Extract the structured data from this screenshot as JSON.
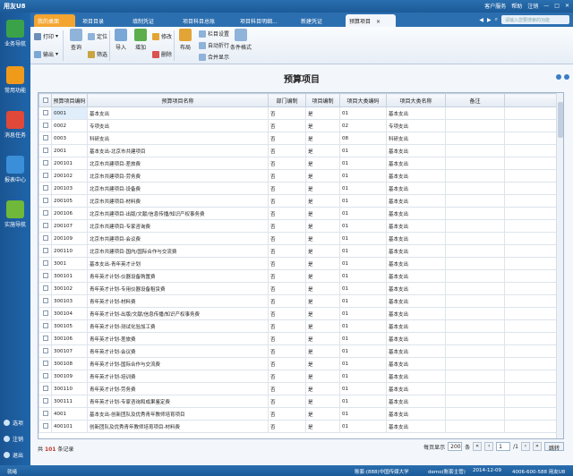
{
  "app": {
    "logo": "用友U8",
    "top_right": [
      "客户服务",
      "帮助",
      "注销"
    ],
    "search_placeholder": "请输入您要搜索的功能"
  },
  "sidebar": {
    "items": [
      {
        "label": "业务导航",
        "color": "#3aa34a"
      },
      {
        "label": "常用功能",
        "color": "#f09a1a"
      },
      {
        "label": "消息任务",
        "color": "#e0483a"
      },
      {
        "label": "报表中心",
        "color": "#3b8fd9"
      },
      {
        "label": "实施导航",
        "color": "#6fb83a"
      }
    ],
    "bottom": [
      "选项",
      "注销",
      "退出"
    ]
  },
  "tabs": [
    {
      "label": "我的桌面"
    },
    {
      "label": "项目目录"
    },
    {
      "label": "填制凭证"
    },
    {
      "label": "项目科目总账"
    },
    {
      "label": "项目科目明细..."
    },
    {
      "label": "新建凭证"
    },
    {
      "label": "预算项目"
    }
  ],
  "toolbar": {
    "print": "打印",
    "output": "输出",
    "query": "查询",
    "locate": "定位",
    "filter": "筛选",
    "import": "导入",
    "add": "增加",
    "modify": "修改",
    "delete": "删除",
    "layout": "布局",
    "column_settings": "栏目设置",
    "auto_wrap": "自动折行",
    "merge_display": "合并显示",
    "cond_format": "条件格式"
  },
  "page": {
    "title": "预算项目"
  },
  "table": {
    "headers": [
      "预算项目编码",
      "预算项目名称",
      "部门编制",
      "项目编制",
      "项目大类编码",
      "项目大类名称",
      "备注"
    ],
    "rows": [
      [
        "0001",
        "基本支出",
        "否",
        "是",
        "01",
        "基本支出"
      ],
      [
        "0002",
        "专项支出",
        "否",
        "是",
        "02",
        "专项支出"
      ],
      [
        "0003",
        "科研支出",
        "否",
        "是",
        "08",
        "科研支出"
      ],
      [
        "2001",
        "基本支出-北京市共建项目",
        "否",
        "是",
        "01",
        "基本支出"
      ],
      [
        "200101",
        "北京市共建项目-差旅费",
        "否",
        "是",
        "01",
        "基本支出"
      ],
      [
        "200102",
        "北京市共建项目-劳务费",
        "否",
        "是",
        "01",
        "基本支出"
      ],
      [
        "200103",
        "北京市共建项目-设备费",
        "否",
        "是",
        "01",
        "基本支出"
      ],
      [
        "200105",
        "北京市共建项目-材料费",
        "否",
        "是",
        "01",
        "基本支出"
      ],
      [
        "200106",
        "北京市共建项目-出版/文献/信息传播/知识产权事务费",
        "否",
        "是",
        "01",
        "基本支出"
      ],
      [
        "200107",
        "北京市共建项目-专家咨询费",
        "否",
        "是",
        "01",
        "基本支出"
      ],
      [
        "200109",
        "北京市共建项目-会议费",
        "否",
        "是",
        "01",
        "基本支出"
      ],
      [
        "200110",
        "北京市共建项目-国内/国际合作与交流费",
        "否",
        "是",
        "01",
        "基本支出"
      ],
      [
        "3001",
        "基本支出-青年英才计划",
        "否",
        "是",
        "01",
        "基本支出"
      ],
      [
        "300101",
        "青年英才计划-仪器设备购置费",
        "否",
        "是",
        "01",
        "基本支出"
      ],
      [
        "300102",
        "青年英才计划-专用仪器设备租赁费",
        "否",
        "是",
        "01",
        "基本支出"
      ],
      [
        "300103",
        "青年英才计划-材料费",
        "否",
        "是",
        "01",
        "基本支出"
      ],
      [
        "300104",
        "青年英才计划-出版/文献/信息传播/知识产权事务费",
        "否",
        "是",
        "01",
        "基本支出"
      ],
      [
        "300105",
        "青年英才计划-测试化验加工费",
        "否",
        "是",
        "01",
        "基本支出"
      ],
      [
        "300106",
        "青年英才计划-差旅费",
        "否",
        "是",
        "01",
        "基本支出"
      ],
      [
        "300107",
        "青年英才计划-会议费",
        "否",
        "是",
        "01",
        "基本支出"
      ],
      [
        "300108",
        "青年英才计划-国际合作与交流费",
        "否",
        "是",
        "01",
        "基本支出"
      ],
      [
        "300109",
        "青年英才计划-培训费",
        "否",
        "是",
        "01",
        "基本支出"
      ],
      [
        "300110",
        "青年英才计划-劳务费",
        "否",
        "是",
        "01",
        "基本支出"
      ],
      [
        "300111",
        "青年英才计划-专家咨询和成果鉴定费",
        "否",
        "是",
        "01",
        "基本支出"
      ],
      [
        "4001",
        "基本支出-创新团队及优秀青年教师培育项目",
        "否",
        "是",
        "01",
        "基本支出"
      ],
      [
        "400101",
        "创新团队及优秀青年教师培育项目-材料费",
        "否",
        "是",
        "01",
        "基本支出"
      ]
    ]
  },
  "footer": {
    "total_prefix": "共",
    "total_count": "101",
    "total_suffix": "条记录",
    "page_size_label": "每页显示",
    "page_size": "200",
    "page_size_unit": "条",
    "current_page": "1",
    "total_pages": "/1",
    "jump": "跳转"
  },
  "statusbar": {
    "ready": "就绪",
    "account": "账套:(888)中国传媒大学",
    "user": "demo(账套主管)",
    "date": "2014-12-09",
    "phone": "4006-600-588 用友U8"
  }
}
